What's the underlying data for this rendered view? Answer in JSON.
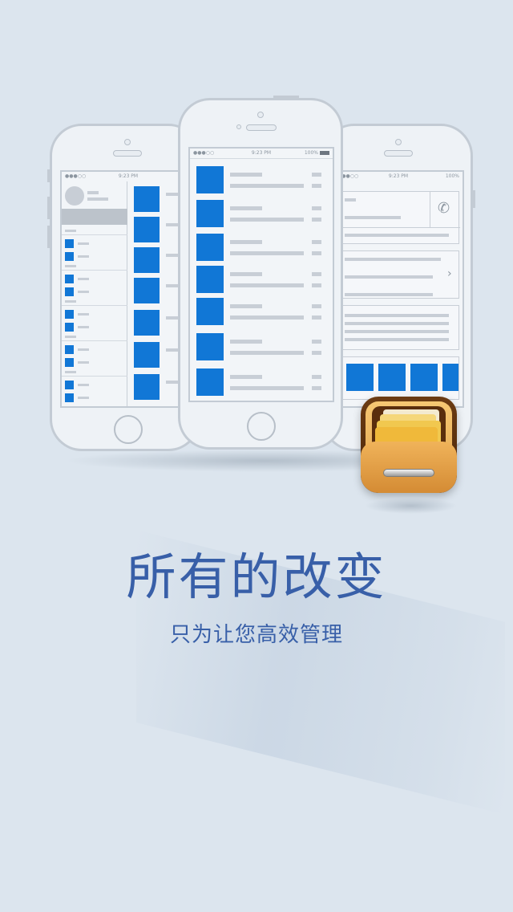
{
  "headline": "所有的改变",
  "subheadline": "只为让您高效管理",
  "phones": {
    "status_time": "9:23 PM",
    "status_battery": "100%",
    "status_signal": "●●●○○"
  },
  "colors": {
    "background": "#dce5ee",
    "accent_blue": "#1177d6",
    "text_blue": "#385fa8",
    "phone_outline": "#c3cbd4"
  },
  "icons": {
    "phone_call": "phone-icon",
    "chevron": "chevron-right-icon",
    "app": "folder-drawer-icon"
  }
}
